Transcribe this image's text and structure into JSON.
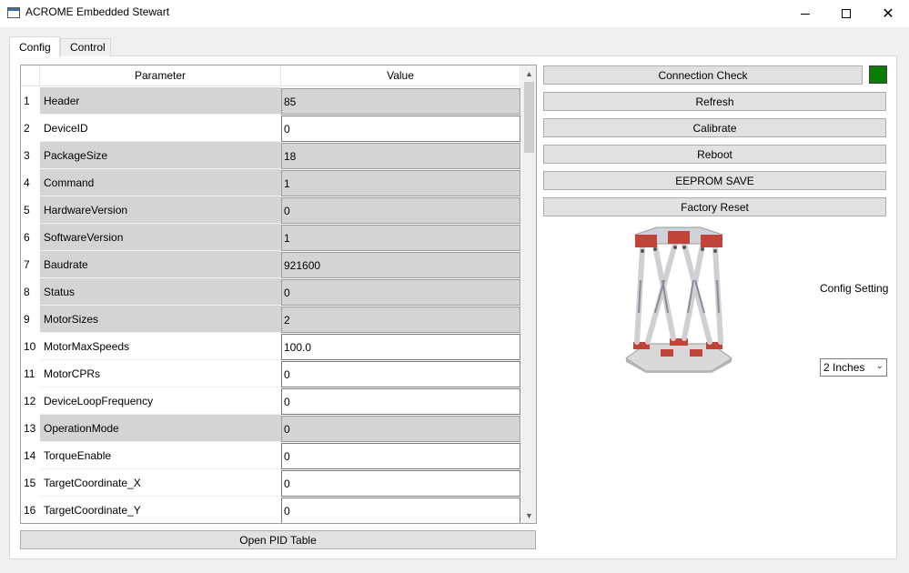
{
  "window": {
    "title": "ACROME Embedded Stewart"
  },
  "tabs": [
    {
      "label": "Config"
    },
    {
      "label": "Control"
    }
  ],
  "table": {
    "headers": {
      "param": "Parameter",
      "value": "Value"
    },
    "rows": [
      {
        "num": "1",
        "param": "Header",
        "value": "85",
        "readonly": true
      },
      {
        "num": "2",
        "param": "DeviceID",
        "value": "0",
        "readonly": false
      },
      {
        "num": "3",
        "param": "PackageSize",
        "value": "18",
        "readonly": true
      },
      {
        "num": "4",
        "param": "Command",
        "value": "1",
        "readonly": true
      },
      {
        "num": "5",
        "param": "HardwareVersion",
        "value": "0",
        "readonly": true
      },
      {
        "num": "6",
        "param": "SoftwareVersion",
        "value": "1",
        "readonly": true
      },
      {
        "num": "7",
        "param": "Baudrate",
        "value": "921600",
        "readonly": true
      },
      {
        "num": "8",
        "param": "Status",
        "value": "0",
        "readonly": true
      },
      {
        "num": "9",
        "param": "MotorSizes",
        "value": "2",
        "readonly": true
      },
      {
        "num": "10",
        "param": "MotorMaxSpeeds",
        "value": "100.0",
        "readonly": false
      },
      {
        "num": "11",
        "param": "MotorCPRs",
        "value": "0",
        "readonly": false
      },
      {
        "num": "12",
        "param": "DeviceLoopFrequency",
        "value": "0",
        "readonly": false
      },
      {
        "num": "13",
        "param": "OperationMode",
        "value": "0",
        "readonly": true
      },
      {
        "num": "14",
        "param": "TorqueEnable",
        "value": "0",
        "readonly": false
      },
      {
        "num": "15",
        "param": "TargetCoordinate_X",
        "value": "0",
        "readonly": false
      },
      {
        "num": "16",
        "param": "TargetCoordinate_Y",
        "value": "0",
        "readonly": false
      }
    ]
  },
  "buttons": {
    "open_pid": "Open PID Table",
    "connection_check": "Connection Check",
    "refresh": "Refresh",
    "calibrate": "Calibrate",
    "reboot": "Reboot",
    "eeprom_save": "EEPROM SAVE",
    "factory_reset": "Factory Reset"
  },
  "status": {
    "connection_color": "#0a7c0a"
  },
  "config": {
    "label": "Config Setting",
    "selected": "2 Inches"
  }
}
